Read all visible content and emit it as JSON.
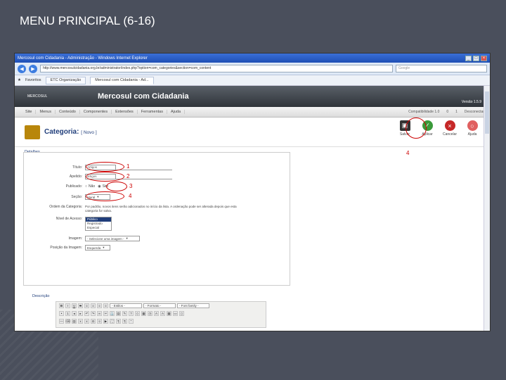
{
  "slide": {
    "title": "MENU PRINCIPAL (6-16)"
  },
  "browser": {
    "window_title": "Mercosul com Cidadania - Administração - Windows Internet Explorer",
    "url": "http://www.mercosulcidadania.org.br/administrator/index.php?option=com_categories&section=com_content",
    "search_placeholder": "Google",
    "tab_favorites": "Favoritos",
    "tab_1": "ETC Organização",
    "tab_2": "Mercosul com Cidadania - Ad..."
  },
  "header": {
    "logo_text": "MERCOSUL",
    "site_name": "Mercosul com Cidadania",
    "version": "Versão 1.5.9"
  },
  "menu": {
    "items": [
      "Site",
      "Menus",
      "Conteúdo",
      "Componentes",
      "Extensões",
      "Ferramentas",
      "Ajuda"
    ],
    "status_preview": "Compatibilidade 1.0",
    "status_messages": "0",
    "status_users": "1",
    "status_logout": "Desconectar"
  },
  "toolbar": {
    "heading": "Categoria:",
    "subheading": "[ Novo ]",
    "save_label": "Salvar",
    "apply_label": "Aplicar",
    "cancel_label": "Cancelar",
    "help_label": "Ajuda"
  },
  "annotations": {
    "a1": "1",
    "a2": "2",
    "a3": "3",
    "a4": "4",
    "a4_save": "4"
  },
  "form": {
    "legend": "Detalhes",
    "title_label": "Título:",
    "title_value": "Artigos",
    "alias_label": "Apelido:",
    "alias_value": "artigos",
    "published_label": "Publicado:",
    "published_no": "Não",
    "published_yes": "Sim",
    "section_label": "Seção:",
    "section_value": "Mural",
    "order_label": "Ordem da Categoria:",
    "order_text": "Por padrão, novos itens serão adicionados no início da lista. A ordenação pode ser alterada depois que esta categoria for salva.",
    "access_label": "Nível de Acesso:",
    "access_options": [
      "Público",
      "Registrado",
      "Especial"
    ],
    "image_label": "Imagem:",
    "image_value": "- Selecione uma imagem -",
    "image_position_label": "Posição da Imagem:",
    "image_position_value": "Esquerda"
  },
  "description": {
    "legend": "Descrição",
    "styles_select": "- Estilos -",
    "format_select": "- Formato -",
    "font_select": "- Font family -"
  }
}
